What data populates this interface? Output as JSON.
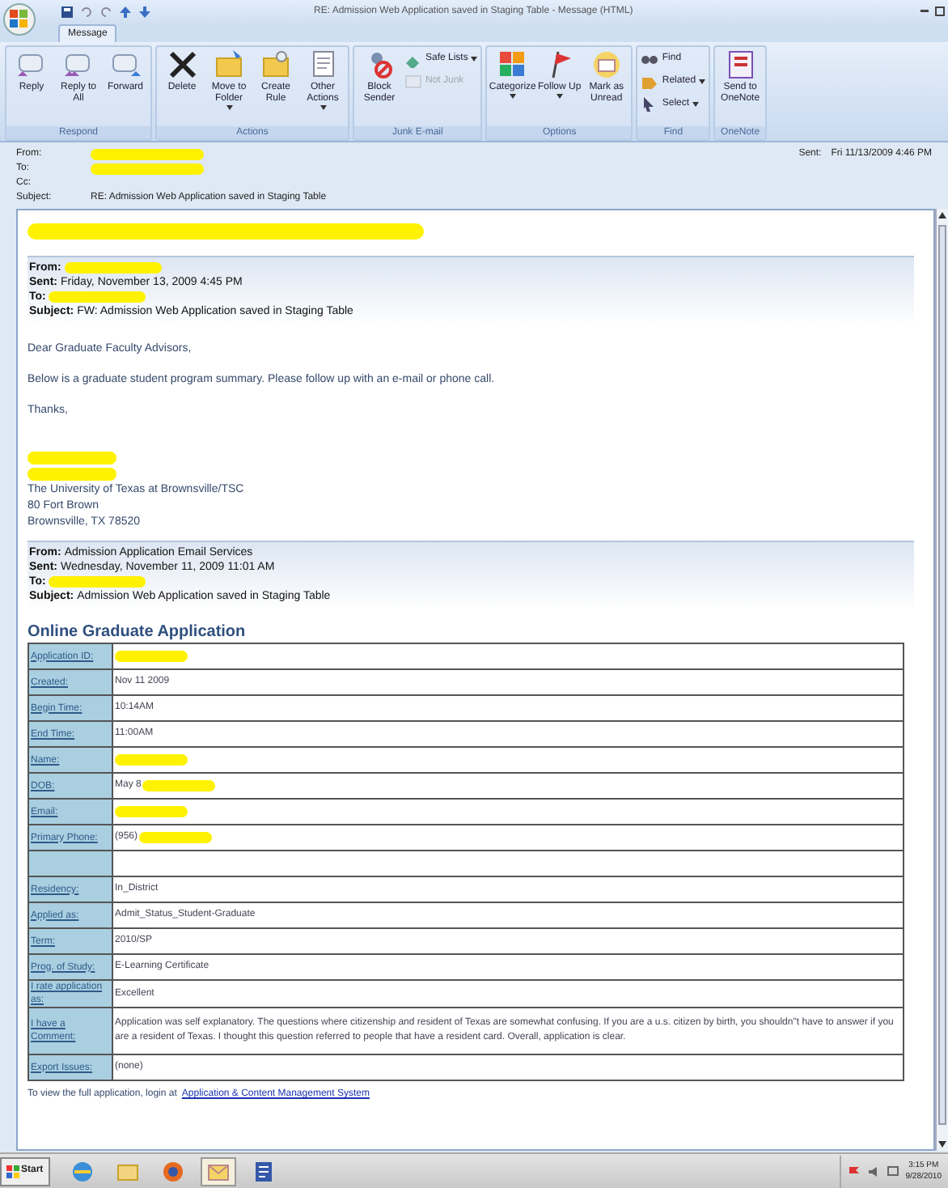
{
  "window": {
    "title": "RE: Admission Web Application saved in Staging Table - Message (HTML)"
  },
  "tabs": [
    {
      "label": "Message",
      "selected": true
    }
  ],
  "ribbon": [
    {
      "group": "Respond",
      "buttons": [
        {
          "kind": "large",
          "label": "Reply"
        },
        {
          "kind": "large",
          "label": "Reply to All"
        },
        {
          "kind": "large",
          "label": "Forward"
        }
      ]
    },
    {
      "group": "Actions",
      "buttons": [
        {
          "kind": "large",
          "label": "Delete"
        },
        {
          "kind": "large",
          "label": "Move to Folder",
          "caret": true
        },
        {
          "kind": "large",
          "label": "Create Rule"
        },
        {
          "kind": "large",
          "label": "Other Actions",
          "caret": true
        }
      ]
    },
    {
      "group": "Junk E-mail",
      "buttons": [
        {
          "kind": "large",
          "label": "Block Sender"
        },
        {
          "kind": "small",
          "label": "Safe Lists",
          "caret": true
        },
        {
          "kind": "small",
          "label": "Not Junk",
          "disabled": true
        }
      ]
    },
    {
      "group": "Options",
      "buttons": [
        {
          "kind": "large",
          "label": "Categorize",
          "caret": true
        },
        {
          "kind": "large",
          "label": "Follow Up",
          "caret": true
        },
        {
          "kind": "large",
          "label": "Mark as Unread"
        }
      ]
    },
    {
      "group": "Find",
      "buttons": [
        {
          "kind": "small",
          "label": "Find"
        },
        {
          "kind": "small",
          "label": "Related",
          "caret": true
        },
        {
          "kind": "small",
          "label": "Select",
          "caret": true
        }
      ]
    },
    {
      "group": "OneNote",
      "buttons": [
        {
          "kind": "large",
          "label": "Send to OneNote"
        }
      ]
    }
  ],
  "header": {
    "fields": [
      {
        "label": "From:",
        "redacted": true
      },
      {
        "label": "To:",
        "redacted": true
      },
      {
        "label": "Cc:"
      },
      {
        "label": "Subject:",
        "value": "RE: Admission Web Application saved in Staging Table"
      }
    ],
    "sent": {
      "label": "Sent:",
      "value": "Fri 11/13/2009 4:46 PM"
    }
  },
  "body": [
    {
      "kind": "redaction"
    },
    {
      "kind": "header",
      "fields": [
        {
          "label": "From:",
          "redacted": true
        },
        {
          "label": "Sent:",
          "value": "Friday, November 13, 2009 4:45 PM"
        },
        {
          "label": "To:",
          "redacted": true
        },
        {
          "label": "Subject:",
          "value": "FW: Admission Web Application saved in Staging Table"
        }
      ]
    },
    {
      "kind": "paragraph",
      "text": "Dear Graduate Faculty Advisors,"
    },
    {
      "kind": "paragraph",
      "text": "Below is a graduate student program summary.  Please follow up with an e-mail or phone call."
    },
    {
      "kind": "paragraph",
      "text": "Thanks,"
    },
    {
      "kind": "signature",
      "lines": [
        {
          "redacted": true
        },
        {
          "redacted": true
        },
        {
          "text": "The University of Texas at Brownsville/TSC"
        },
        {
          "text": "80 Fort Brown"
        },
        {
          "text": "Brownsville, TX  78520"
        }
      ]
    },
    {
      "kind": "header",
      "fields": [
        {
          "label": "From:",
          "value": "Admission Application Email Services"
        },
        {
          "label": "Sent:",
          "value": "Wednesday, November 11, 2009 11:01 AM"
        },
        {
          "label": "To:",
          "redacted": true
        },
        {
          "label": "Subject:",
          "value": "Admission Web Application saved in Staging Table"
        }
      ]
    },
    {
      "kind": "heading",
      "text": "Online Graduate Application"
    },
    {
      "kind": "table",
      "rows": [
        {
          "kind": "field",
          "label": "Application ID:",
          "redacted": true
        },
        {
          "kind": "field",
          "label": "Created:",
          "value": "Nov 11 2009"
        },
        {
          "kind": "field",
          "label": "Begin Time:",
          "value": "10:14AM"
        },
        {
          "kind": "field",
          "label": "End Time:",
          "value": "11:00AM"
        },
        {
          "kind": "field",
          "label": "Name:",
          "redacted": true
        },
        {
          "kind": "field",
          "label": "DOB:",
          "value": "May 8",
          "redacted": true
        },
        {
          "kind": "field",
          "label": "Email:",
          "redacted": true
        },
        {
          "kind": "field",
          "label": "Primary Phone:",
          "value": "(956)",
          "redacted": true
        },
        {
          "kind": "blank"
        },
        {
          "kind": "field",
          "label": "Residency:",
          "value": "In_District"
        },
        {
          "kind": "field",
          "label": "Applied as:",
          "value": "Admit_Status_Student-Graduate"
        },
        {
          "kind": "field",
          "label": "Term:",
          "value": "2010/SP"
        },
        {
          "kind": "field",
          "label": "Prog. of Study:",
          "value": "E-Learning Certificate"
        },
        {
          "kind": "field",
          "label": "I rate application as:",
          "value": "Excellent"
        },
        {
          "kind": "field",
          "label": "I have a Comment:",
          "value": "Application was self explanatory. The questions where citizenship and resident of Texas are somewhat confusing. If you are a u.s. citizen by birth, you shouldn\"t have to answer if you are a resident of Texas. I thought this question referred to people that have a resident card. Overall, application is clear."
        },
        {
          "kind": "field",
          "label": "Export Issues:",
          "value": "(none)"
        }
      ]
    },
    {
      "kind": "footer",
      "text": "To view the full application, login at",
      "link": "Application & Content Management System"
    }
  ],
  "taskbar": {
    "start": "Start",
    "apps": [
      {
        "selected": false
      },
      {
        "selected": false
      },
      {
        "selected": false
      },
      {
        "selected": true
      },
      {
        "selected": false
      }
    ],
    "time": "3:15 PM",
    "date": "9/28/2010"
  }
}
